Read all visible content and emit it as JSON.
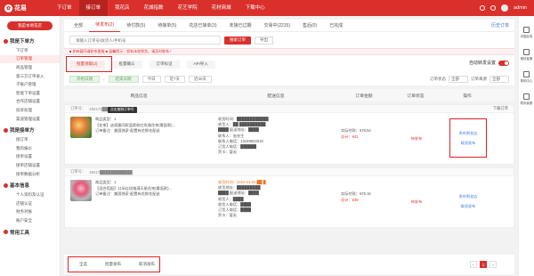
{
  "header": {
    "brand": "花易",
    "nav": [
      "下订单",
      "接订单",
      "我花店",
      "花城指数",
      "花艺学院",
      "花材商城",
      "下载中心"
    ],
    "user": "admin"
  },
  "sidebar": {
    "shop_button": "我是本地花店",
    "groups": [
      {
        "title": "我是下单方",
        "items": [
          "下订单",
          "订单管理",
          "商品管理",
          "第三方订单录入",
          "子账户管理",
          "智能下单设置",
          "合作店铺设置",
          "投诉处理",
          "渠道管理设置"
        ]
      },
      {
        "title": "我是接单方",
        "items": [
          "接订单",
          "我的报价",
          "接单设置",
          "接单店铺设置",
          "接单数据分析"
        ]
      },
      {
        "title": "基本信息",
        "items": [
          "个人资料及认证",
          "店铺认证",
          "财务对账",
          "账户安全"
        ]
      },
      {
        "title": "常用工具",
        "items": []
      }
    ]
  },
  "tabs": {
    "items": [
      "全部",
      "待发布(2)",
      "待付款(5)",
      "待接单(5)",
      "花店已接单(3)",
      "未接已过期",
      "交易中(2215)",
      "售后(0)",
      "已完成"
    ],
    "active": 1,
    "right": "历史订单"
  },
  "search": {
    "placeholder": "请输入订单号/收货人/手机号",
    "button": "搜索订单",
    "export": "导出"
  },
  "notice": "■ 如有疑问请联系客服 ■ 温馨提示：如有未收到货，请及时联系！",
  "actions": {
    "items": [
      "批量领取(2)",
      "批量确认",
      "订单标记",
      "API导入"
    ],
    "toggle_label": "自动转发设置"
  },
  "filters": {
    "date_from": "开始日期",
    "date_to": "结束日期",
    "today": "今日",
    "week": "近7天",
    "month": "近30天",
    "label_left": "订单状态",
    "label_right": "订单来源",
    "sel_left": "全部",
    "sel_right": "全部"
  },
  "table": {
    "headers": [
      "商品信息",
      "配送信息",
      "订单金额",
      "订单状态",
      "操作"
    ]
  },
  "orders": [
    {
      "head_no": "订单号：",
      "no": "284174█████070",
      "tooltip": "点击复制订单号",
      "r": "下载订单",
      "type": "商品类型：1",
      "name": "【花束】送闺蜜同款温柔粉红玫瑰花束(雾面款)...",
      "remark": "订单备注：美国独家-配置有花鲜花配送",
      "recv": "收货时间：████████████",
      "addr1": "收货人：██ ██████████",
      "addr2": "████ 配送地址：████",
      "addr3": "联系人：张先生",
      "phone": "联系人电话：13169823018",
      "addr5": "订货人电话：██████",
      "addr6": "贺卡：暂无",
      "amount": "实际付款：¥78.54",
      "fee": "总计：¥41",
      "status": "待发布",
      "op1": "发布到花店",
      "op2": "取消发布"
    },
    {
      "head_no": "订单号：",
      "no": "28417████████████",
      "r": "",
      "type": "商品类型：1",
      "name": "【混合搭配】11朵红玫瑰满天星花束(雾面款)...",
      "remark": "订单备注：美国独家-配置有花鲜花配送",
      "recv": "收货时间：2024-01-02 ██ █",
      "addr1": "收货地址：█████████",
      "addr2": "████ 配送地址：████",
      "addr3": "收货人：████",
      "phone": "收货人电话：████",
      "addr5": "订货人电话：████",
      "addr6": "贺卡：暂无",
      "amount": "实际付款：¥75.16",
      "fee": "总计：¥39",
      "status": "待发布",
      "op1": "发布到花店",
      "op2": "取消发布"
    }
  ],
  "bottom": {
    "items": [
      "全选",
      "批量发布",
      "取消发布"
    ],
    "pages": [
      "‹",
      "1",
      "›"
    ]
  },
  "right_tools": [
    "问题反馈",
    "微信客服",
    "帮助中心",
    "联系客服"
  ]
}
